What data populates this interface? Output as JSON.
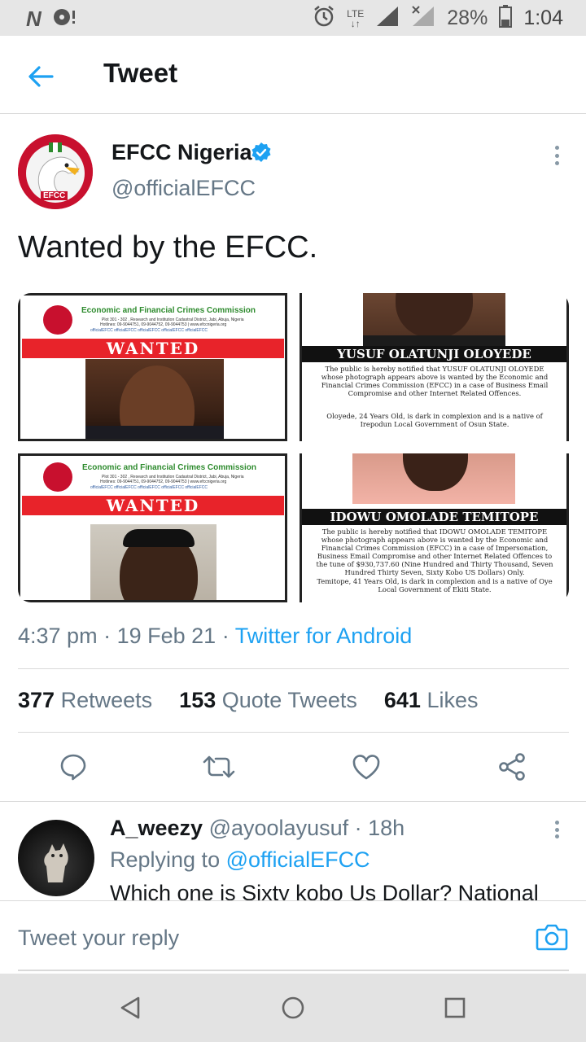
{
  "status_bar": {
    "left_letter": "N",
    "lte": "LTE",
    "battery": "28%",
    "time": "1:04"
  },
  "app_bar": {
    "title": "Tweet"
  },
  "tweet": {
    "author_name": "EFCC Nigeria",
    "author_handle": "@officialEFCC",
    "avatar_label": "EFCC",
    "text": "Wanted by the EFCC.",
    "time": "4:37 pm",
    "date": "19 Feb 21",
    "source": "Twitter for Android",
    "stats": {
      "retweets_count": "377",
      "retweets_label": "Retweets",
      "quotes_count": "153",
      "quotes_label": "Quote Tweets",
      "likes_count": "641",
      "likes_label": "Likes"
    }
  },
  "media": {
    "poster_header": {
      "org": "Economic and Financial Crimes Commission",
      "address": "Plot 301 - 302 , Research and Institution Cadastral District, Jabi, Abuja, Nigeria",
      "hotlines": "Hotlines: 09-9044751, 09-9044752, 09-9044753 | www.efccnigeria.org",
      "social": "officialEFCC   officialEFCC   officialEFCC   officialEFCC   officialEFCC",
      "logo_label": "EFCC"
    },
    "wanted_label": "WANTED",
    "poster2": {
      "name": "YUSUF OLATUNJI OLOYEDE",
      "notice": "The public is hereby notified that YUSUF OLATUNJI OLOYEDE whose photograph appears above is wanted by the Economic and Financial Crimes Commission (EFCC) in a case of Business Email Compromise and other Internet Related Offences.",
      "details": "Oloyede, 24 Years Old, is dark in complexion and is a native of Irepodun Local Government of Osun State."
    },
    "poster4": {
      "name": "IDOWU OMOLADE TEMITOPE",
      "notice": "The public is hereby notified that IDOWU OMOLADE TEMITOPE whose photograph appears above is wanted by the Economic and Financial Crimes Commission (EFCC) in a case of Impersonation, Business Email Compromise and other Internet Related Offences to the tune of $930,737.60 (Nine Hundred and Thirty Thousand, Seven Hundred Thirty Seven, Sixty Kobo US Dollars) Only.",
      "details": "Temitope, 41 Years Old, is dark in complexion and is a native of Oye Local Government of Ekiti State."
    }
  },
  "reply": {
    "name": "A_weezy",
    "handle": "@ayoolayusuf",
    "time": "18h",
    "replying_label": "Replying to",
    "replying_to": "@officialEFCC",
    "text": "Which one is Sixty kobo Us Dollar? National"
  },
  "composer": {
    "placeholder": "Tweet your reply"
  },
  "colors": {
    "accent": "#1da1f2",
    "secondary_text": "#657786",
    "efcc_red": "#c8102e",
    "wanted_red": "#e8232a"
  }
}
